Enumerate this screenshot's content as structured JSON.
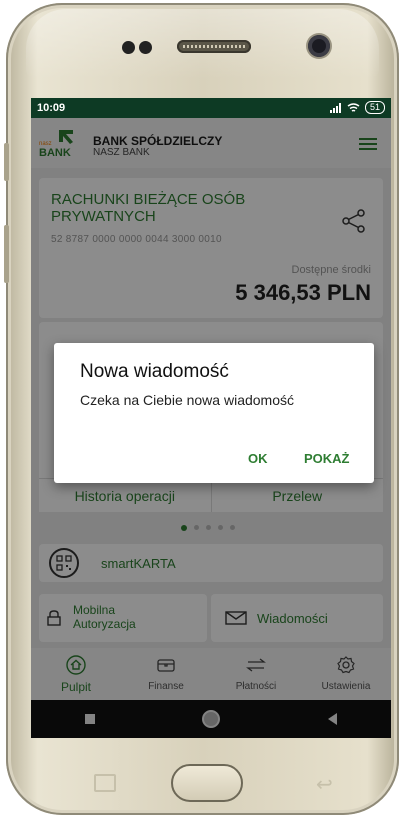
{
  "status": {
    "time": "10:09",
    "battery": "51"
  },
  "header": {
    "bank_name": "BANK SPÓŁDZIELCZY",
    "bank_sub": "NASZ BANK",
    "logo_top": "nasz",
    "logo_bottom": "BANK"
  },
  "account": {
    "title": "RACHUNKI BIEŻĄCE OSÓB PRYWATNYCH",
    "number": "52 8787 0000 0000 0044 3000 0010",
    "available_label": "Dostępne środki",
    "balance": "5 346,53 PLN"
  },
  "actions": {
    "history": "Historia operacji",
    "transfer": "Przelew"
  },
  "smartkarta": {
    "label": "smartKARTA"
  },
  "tiles": {
    "mobile_auth": "Mobilna Autoryzacja",
    "messages": "Wiadomości"
  },
  "tabs": [
    {
      "label": "Pulpit",
      "active": true,
      "icon": "home-icon"
    },
    {
      "label": "Finanse",
      "active": false,
      "icon": "wallet-icon"
    },
    {
      "label": "Płatności",
      "active": false,
      "icon": "transfer-arrows-icon"
    },
    {
      "label": "Ustawienia",
      "active": false,
      "icon": "gear-icon"
    }
  ],
  "dialog": {
    "title": "Nowa wiadomość",
    "message": "Czeka na Ciebie nowa wiadomość",
    "ok_label": "OK",
    "show_label": "POKAŻ"
  },
  "colors": {
    "accent": "#2e7d32",
    "status_bar": "#0d3a24",
    "overlay": "rgba(0,0,0,0.45)"
  }
}
